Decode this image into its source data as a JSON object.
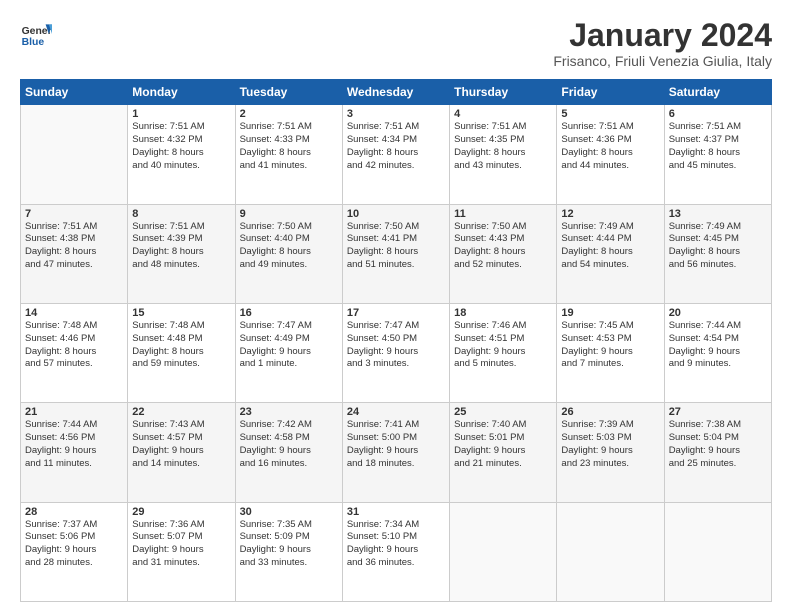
{
  "header": {
    "logo_general": "General",
    "logo_blue": "Blue",
    "title": "January 2024",
    "subtitle": "Frisanco, Friuli Venezia Giulia, Italy"
  },
  "weekdays": [
    "Sunday",
    "Monday",
    "Tuesday",
    "Wednesday",
    "Thursday",
    "Friday",
    "Saturday"
  ],
  "weeks": [
    [
      {
        "day": "",
        "info": ""
      },
      {
        "day": "1",
        "info": "Sunrise: 7:51 AM\nSunset: 4:32 PM\nDaylight: 8 hours\nand 40 minutes."
      },
      {
        "day": "2",
        "info": "Sunrise: 7:51 AM\nSunset: 4:33 PM\nDaylight: 8 hours\nand 41 minutes."
      },
      {
        "day": "3",
        "info": "Sunrise: 7:51 AM\nSunset: 4:34 PM\nDaylight: 8 hours\nand 42 minutes."
      },
      {
        "day": "4",
        "info": "Sunrise: 7:51 AM\nSunset: 4:35 PM\nDaylight: 8 hours\nand 43 minutes."
      },
      {
        "day": "5",
        "info": "Sunrise: 7:51 AM\nSunset: 4:36 PM\nDaylight: 8 hours\nand 44 minutes."
      },
      {
        "day": "6",
        "info": "Sunrise: 7:51 AM\nSunset: 4:37 PM\nDaylight: 8 hours\nand 45 minutes."
      }
    ],
    [
      {
        "day": "7",
        "info": "Sunrise: 7:51 AM\nSunset: 4:38 PM\nDaylight: 8 hours\nand 47 minutes."
      },
      {
        "day": "8",
        "info": "Sunrise: 7:51 AM\nSunset: 4:39 PM\nDaylight: 8 hours\nand 48 minutes."
      },
      {
        "day": "9",
        "info": "Sunrise: 7:50 AM\nSunset: 4:40 PM\nDaylight: 8 hours\nand 49 minutes."
      },
      {
        "day": "10",
        "info": "Sunrise: 7:50 AM\nSunset: 4:41 PM\nDaylight: 8 hours\nand 51 minutes."
      },
      {
        "day": "11",
        "info": "Sunrise: 7:50 AM\nSunset: 4:43 PM\nDaylight: 8 hours\nand 52 minutes."
      },
      {
        "day": "12",
        "info": "Sunrise: 7:49 AM\nSunset: 4:44 PM\nDaylight: 8 hours\nand 54 minutes."
      },
      {
        "day": "13",
        "info": "Sunrise: 7:49 AM\nSunset: 4:45 PM\nDaylight: 8 hours\nand 56 minutes."
      }
    ],
    [
      {
        "day": "14",
        "info": "Sunrise: 7:48 AM\nSunset: 4:46 PM\nDaylight: 8 hours\nand 57 minutes."
      },
      {
        "day": "15",
        "info": "Sunrise: 7:48 AM\nSunset: 4:48 PM\nDaylight: 8 hours\nand 59 minutes."
      },
      {
        "day": "16",
        "info": "Sunrise: 7:47 AM\nSunset: 4:49 PM\nDaylight: 9 hours\nand 1 minute."
      },
      {
        "day": "17",
        "info": "Sunrise: 7:47 AM\nSunset: 4:50 PM\nDaylight: 9 hours\nand 3 minutes."
      },
      {
        "day": "18",
        "info": "Sunrise: 7:46 AM\nSunset: 4:51 PM\nDaylight: 9 hours\nand 5 minutes."
      },
      {
        "day": "19",
        "info": "Sunrise: 7:45 AM\nSunset: 4:53 PM\nDaylight: 9 hours\nand 7 minutes."
      },
      {
        "day": "20",
        "info": "Sunrise: 7:44 AM\nSunset: 4:54 PM\nDaylight: 9 hours\nand 9 minutes."
      }
    ],
    [
      {
        "day": "21",
        "info": "Sunrise: 7:44 AM\nSunset: 4:56 PM\nDaylight: 9 hours\nand 11 minutes."
      },
      {
        "day": "22",
        "info": "Sunrise: 7:43 AM\nSunset: 4:57 PM\nDaylight: 9 hours\nand 14 minutes."
      },
      {
        "day": "23",
        "info": "Sunrise: 7:42 AM\nSunset: 4:58 PM\nDaylight: 9 hours\nand 16 minutes."
      },
      {
        "day": "24",
        "info": "Sunrise: 7:41 AM\nSunset: 5:00 PM\nDaylight: 9 hours\nand 18 minutes."
      },
      {
        "day": "25",
        "info": "Sunrise: 7:40 AM\nSunset: 5:01 PM\nDaylight: 9 hours\nand 21 minutes."
      },
      {
        "day": "26",
        "info": "Sunrise: 7:39 AM\nSunset: 5:03 PM\nDaylight: 9 hours\nand 23 minutes."
      },
      {
        "day": "27",
        "info": "Sunrise: 7:38 AM\nSunset: 5:04 PM\nDaylight: 9 hours\nand 25 minutes."
      }
    ],
    [
      {
        "day": "28",
        "info": "Sunrise: 7:37 AM\nSunset: 5:06 PM\nDaylight: 9 hours\nand 28 minutes."
      },
      {
        "day": "29",
        "info": "Sunrise: 7:36 AM\nSunset: 5:07 PM\nDaylight: 9 hours\nand 31 minutes."
      },
      {
        "day": "30",
        "info": "Sunrise: 7:35 AM\nSunset: 5:09 PM\nDaylight: 9 hours\nand 33 minutes."
      },
      {
        "day": "31",
        "info": "Sunrise: 7:34 AM\nSunset: 5:10 PM\nDaylight: 9 hours\nand 36 minutes."
      },
      {
        "day": "",
        "info": ""
      },
      {
        "day": "",
        "info": ""
      },
      {
        "day": "",
        "info": ""
      }
    ]
  ]
}
